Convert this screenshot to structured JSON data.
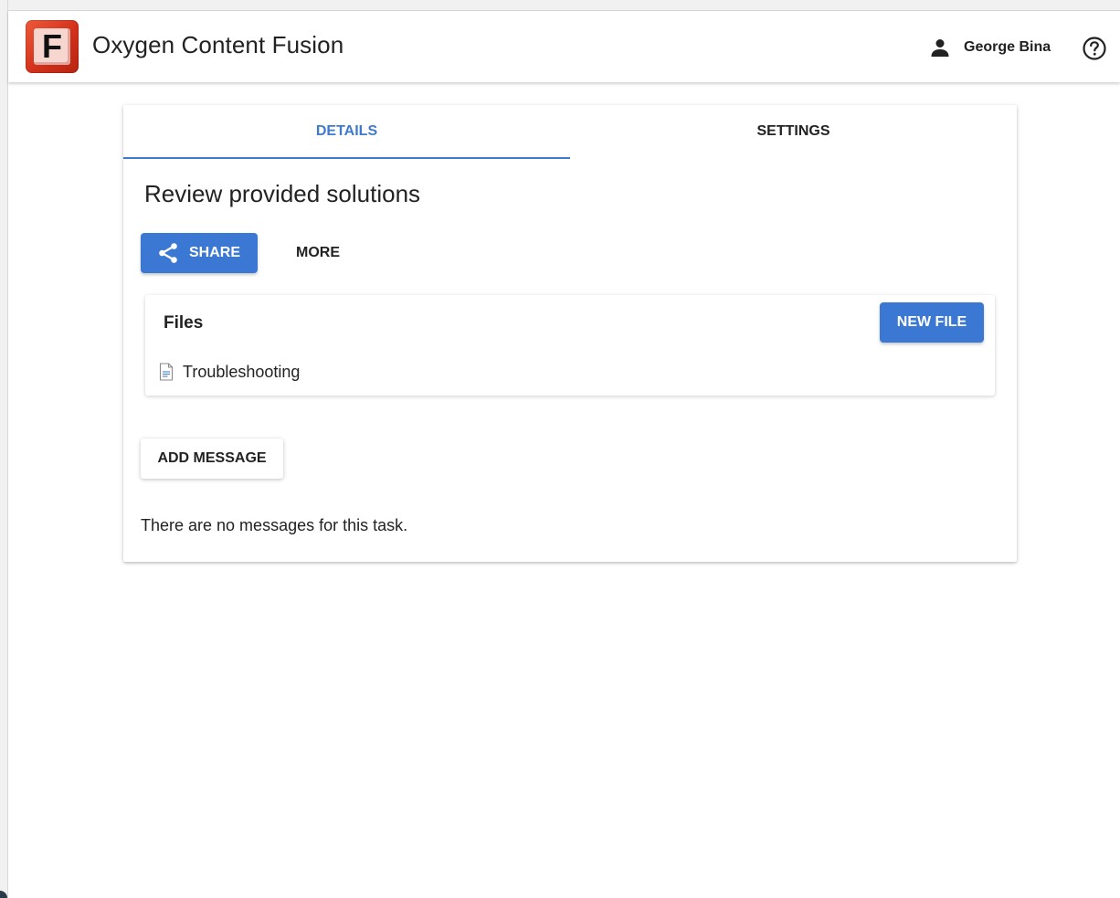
{
  "header": {
    "logo_letter": "F",
    "app_title": "Oxygen Content Fusion",
    "user_icon": "person-icon",
    "user_name": "George Bina",
    "help_icon": "help-circle-icon"
  },
  "tabs": [
    {
      "label": "DETAILS",
      "active": true
    },
    {
      "label": "SETTINGS",
      "active": false
    }
  ],
  "task": {
    "title": "Review provided solutions",
    "share_icon": "share-icon",
    "share_label": "SHARE",
    "more_label": "MORE"
  },
  "files": {
    "title": "Files",
    "new_file_label": "NEW FILE",
    "items": [
      {
        "icon": "document-icon",
        "name": "Troubleshooting"
      }
    ]
  },
  "messages": {
    "add_label": "ADD MESSAGE",
    "empty_text": "There are no messages for this task."
  },
  "colors": {
    "accent": "#3a78d3",
    "tab_active": "#3f7bcc",
    "logo": "#d2311a"
  }
}
